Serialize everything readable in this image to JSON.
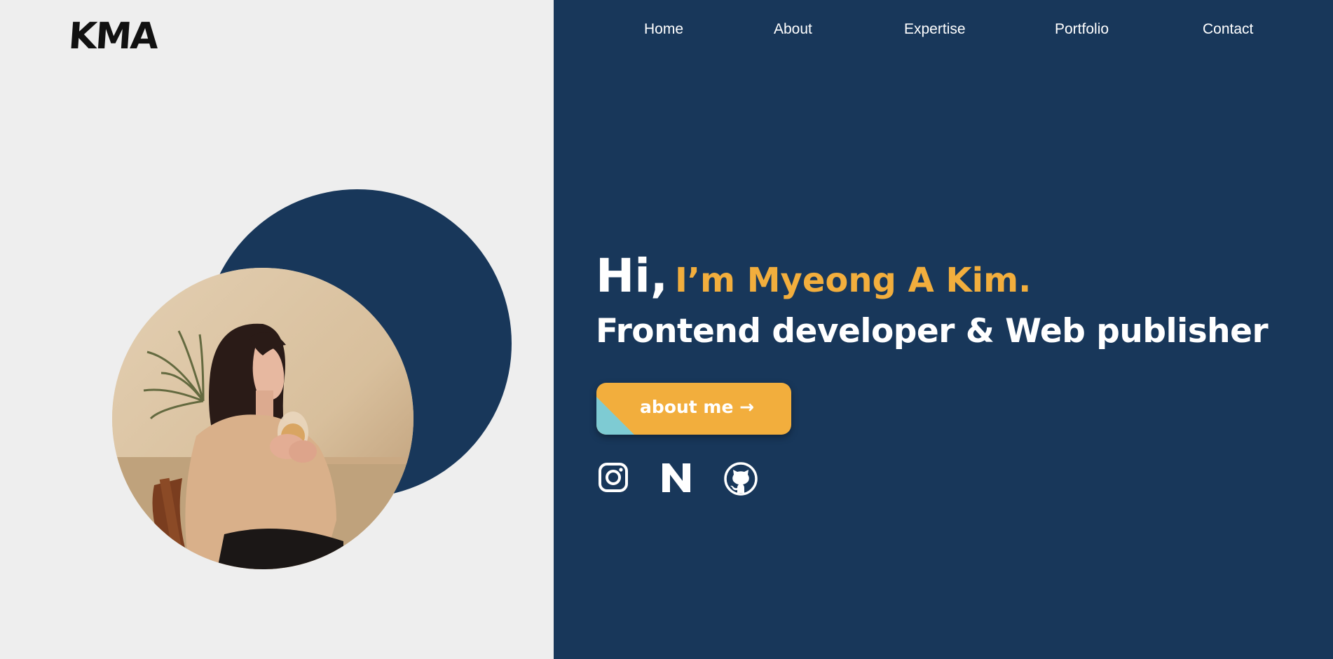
{
  "logo": {
    "text": "KMA"
  },
  "nav": {
    "items": [
      {
        "label": "Home"
      },
      {
        "label": "About"
      },
      {
        "label": "Expertise"
      },
      {
        "label": "Portfolio"
      },
      {
        "label": "Contact"
      }
    ]
  },
  "hero": {
    "greeting": "Hi,",
    "name": "I’m Myeong A Kim.",
    "tagline": "Frontend developer & Web publisher",
    "button_label": "about me →"
  },
  "socials": [
    {
      "icon": "instagram-icon"
    },
    {
      "icon": "notion-icon"
    },
    {
      "icon": "github-icon"
    }
  ],
  "colors": {
    "navy": "#18375a",
    "background": "#eeeeee",
    "accent": "#f2ae3d",
    "teal": "#7ecbd3",
    "white": "#ffffff"
  }
}
